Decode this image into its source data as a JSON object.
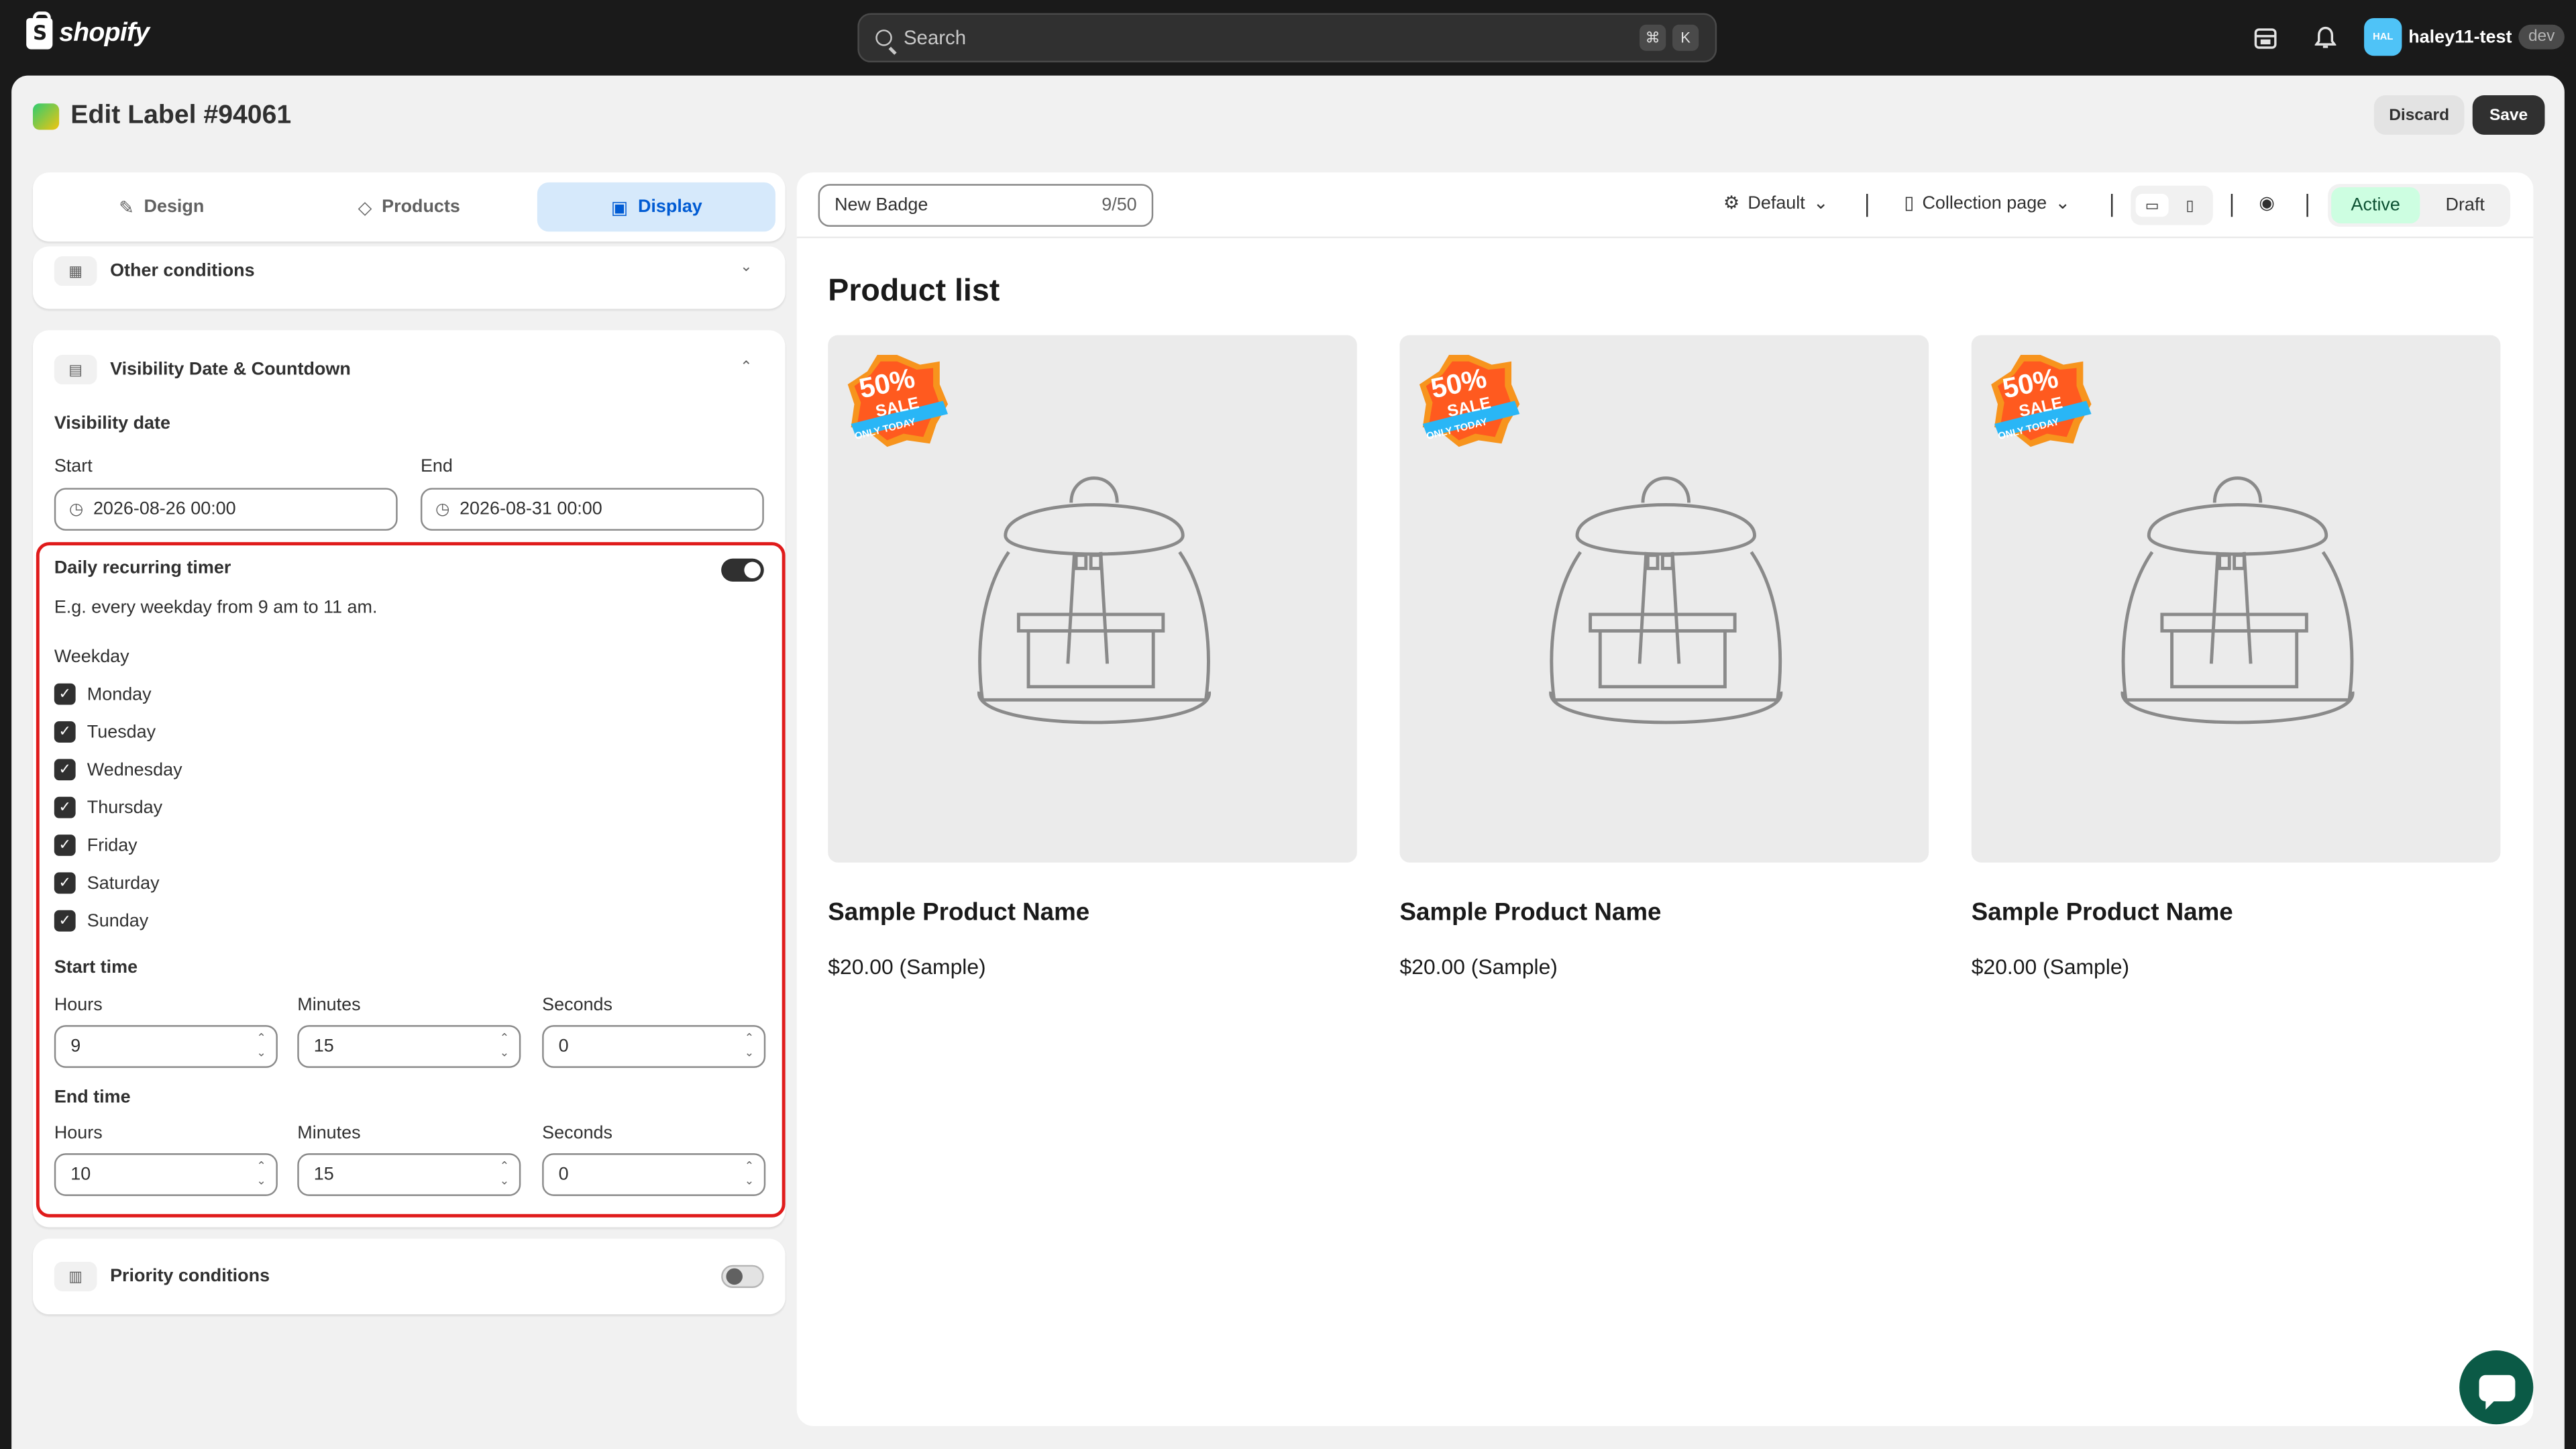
{
  "topbar": {
    "logo_text": "shopify",
    "search_placeholder": "Search",
    "shortcut_keys": [
      "⌘",
      "K"
    ],
    "icons": [
      "store-icon",
      "bell-icon"
    ],
    "user": {
      "avatar_text": "HAL",
      "name": "haley11-test",
      "env": "dev"
    }
  },
  "header": {
    "title": "Edit Label #94061",
    "discard_label": "Discard",
    "save_label": "Save"
  },
  "tabs": [
    {
      "label": "Design",
      "icon": "magic-wand-icon"
    },
    {
      "label": "Products",
      "icon": "tag-icon"
    },
    {
      "label": "Display",
      "icon": "image-icon",
      "active": true
    }
  ],
  "other_conditions": {
    "label": "Other conditions"
  },
  "visibility": {
    "section_label": "Visibility Date & Countdown",
    "date_label": "Visibility date",
    "start_label": "Start",
    "start_value": "2026-08-26 00:00",
    "end_label": "End",
    "end_value": "2026-08-31 00:00",
    "recurring": {
      "label": "Daily recurring timer",
      "enabled": true,
      "hint": "E.g. every weekday from 9 am to 11 am.",
      "weekday_label": "Weekday",
      "days": [
        "Monday",
        "Tuesday",
        "Wednesday",
        "Thursday",
        "Friday",
        "Saturday",
        "Sunday"
      ],
      "start_time_label": "Start time",
      "end_time_label": "End time",
      "hours_label": "Hours",
      "minutes_label": "Minutes",
      "seconds_label": "Seconds",
      "start": {
        "hours": "9",
        "minutes": "15",
        "seconds": "0"
      },
      "end": {
        "hours": "10",
        "minutes": "15",
        "seconds": "0"
      }
    }
  },
  "priority": {
    "label": "Priority conditions",
    "enabled": false
  },
  "preview": {
    "badge_name": "New Badge",
    "badge_count": "9/50",
    "theme": "Default",
    "page": "Collection page",
    "status_active": "Active",
    "status_draft": "Draft",
    "list_title": "Product list",
    "badge_text": {
      "big": "50%",
      "mid": "SALE",
      "small": "ONLY TODAY"
    },
    "products": [
      {
        "name": "Sample Product Name",
        "price": "$20.00 (Sample)"
      },
      {
        "name": "Sample Product Name",
        "price": "$20.00 (Sample)"
      },
      {
        "name": "Sample Product Name",
        "price": "$20.00 (Sample)"
      }
    ]
  },
  "colors": {
    "accent": "#005bd3",
    "active_status": "#cdfee1",
    "highlight": "#e01b1b",
    "chat": "#0b5a46"
  }
}
